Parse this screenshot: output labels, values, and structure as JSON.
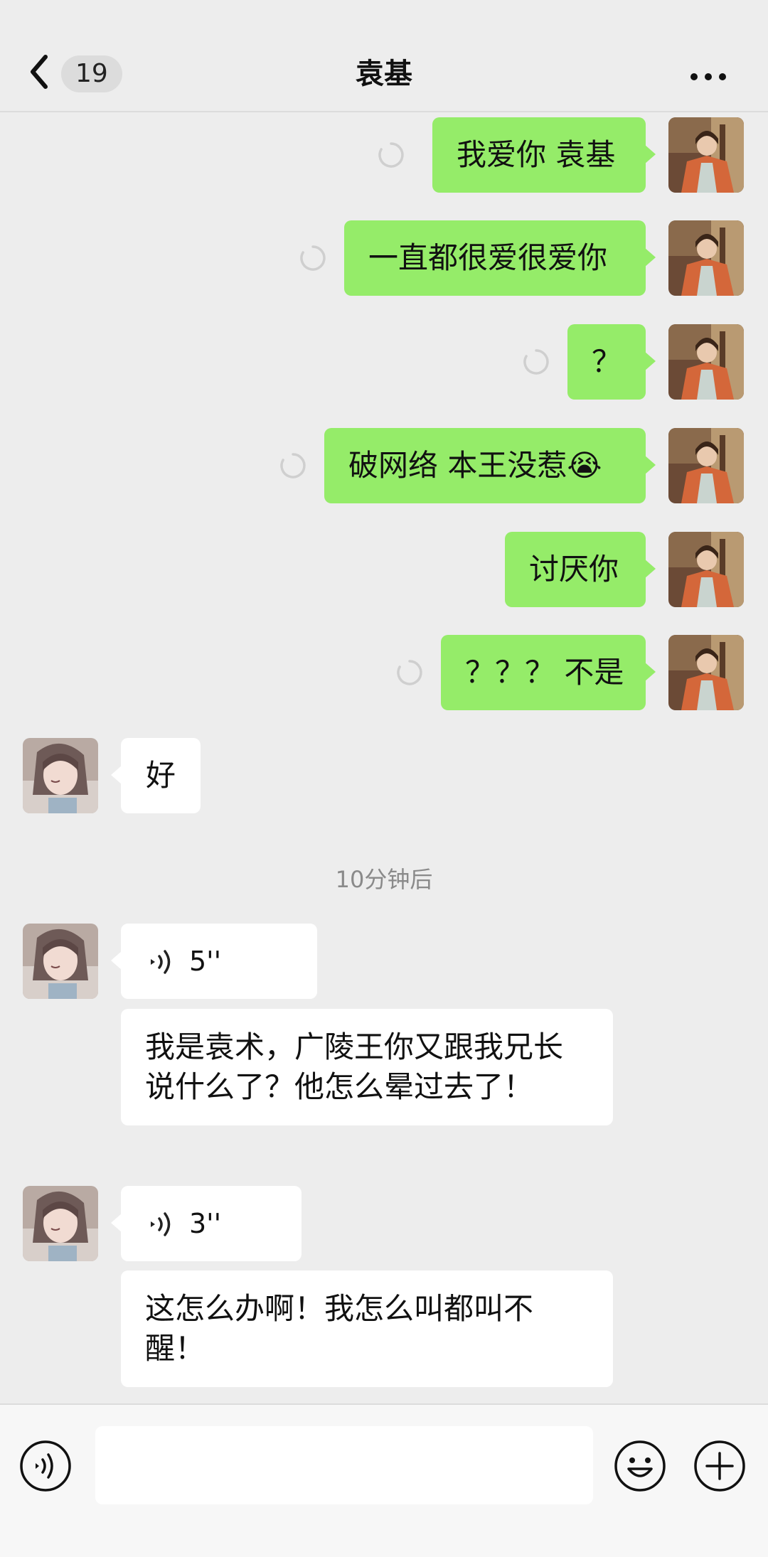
{
  "header": {
    "title": "袁基",
    "unread_count": "19",
    "back_icon": "chevron-left-icon",
    "more_icon": "more-dots-icon"
  },
  "messages_sent": [
    {
      "text": "我爱你 袁基",
      "status": "sending"
    },
    {
      "text": "一直都很爱很爱你",
      "status": "sending"
    },
    {
      "text": "？",
      "status": "sending"
    },
    {
      "text": "破网络 本王没惹😭",
      "status": "sending"
    },
    {
      "text": "讨厌你",
      "status": "sent"
    },
    {
      "text": "？？？ 不是",
      "status": "sending"
    }
  ],
  "messages_received_1": {
    "text": "好"
  },
  "timestamp": "10分钟后",
  "voice_1": {
    "duration": "5''"
  },
  "text_1": {
    "text": "我是袁术，广陵王你又跟我兄长说什么了？他怎么晕过去了！"
  },
  "voice_2": {
    "duration": "3''"
  },
  "text_2": {
    "text": "这怎么办啊！我怎么叫都叫不醒！"
  },
  "bottom_bar": {
    "voice_icon": "voice-input-icon",
    "emoji_icon": "emoji-icon",
    "plus_icon": "plus-icon"
  },
  "colors": {
    "background": "#EDEDED",
    "sent_bubble": "#95EC69",
    "received_bubble": "#FFFFFF"
  }
}
